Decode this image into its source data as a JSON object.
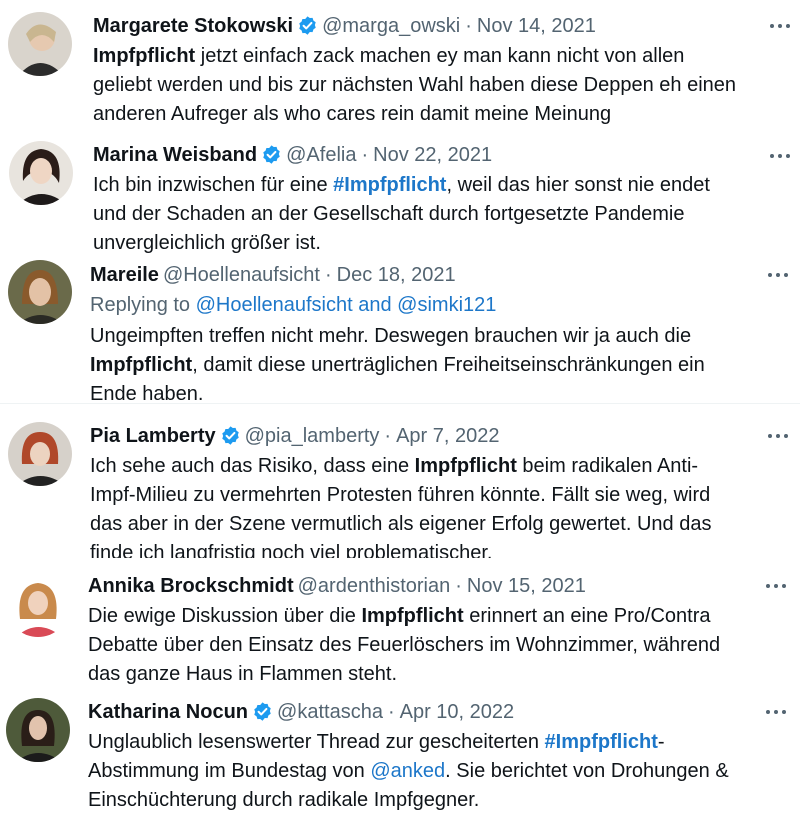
{
  "colors": {
    "link": "#1d77c9",
    "verified": "#1d9bf0",
    "muted": "#536471",
    "text": "#0f1419"
  },
  "icons": {
    "verified": "verified-badge-icon",
    "more": "more-options-icon"
  },
  "tweets": [
    {
      "name": "Margarete Stokowski",
      "verified": true,
      "handle": "@marga_owski",
      "dot": "·",
      "date": "Nov 14, 2021",
      "lines": [
        {
          "bold": "Impfpflicht",
          "rest": " jetzt einfach zack machen ey man kann nicht von allen"
        },
        {
          "text": "geliebt werden und bis zur nächsten Wahl haben diese Deppen eh einen"
        },
        {
          "text": "anderen Aufreger als who cares rein damit meine Meinung"
        }
      ]
    },
    {
      "name": "Marina Weisband",
      "verified": true,
      "handle": "@Afelia",
      "dot": "·",
      "date": "Nov 22, 2021",
      "lines": [
        {
          "pre": "Ich bin inzwischen für eine ",
          "tag": "#Impfpflicht",
          "post": ", weil das hier sonst nie endet"
        },
        {
          "text": "und der Schaden an der Gesellschaft durch fortgesetzte Pandemie"
        },
        {
          "text": "unvergleichlich größer ist."
        }
      ]
    },
    {
      "name": "Mareile",
      "verified": false,
      "handle": "@Hoellenaufsicht",
      "dot": "·",
      "date": "Dec 18, 2021",
      "reply": {
        "prefix": "Replying to ",
        "link1": "@Hoellenaufsicht",
        "and": " and ",
        "link2": "@simki121"
      },
      "lines": [
        {
          "text": "Ungeimpften treffen nicht mehr. Deswegen brauchen wir ja auch die"
        },
        {
          "bold": "Impfpflicht",
          "rest": ", damit diese unerträglichen Freiheitseinschränkungen ein"
        },
        {
          "text": "Ende haben."
        }
      ]
    },
    {
      "name": "Pia Lamberty",
      "verified": true,
      "handle": "@pia_lamberty",
      "dot": "·",
      "date": "Apr 7, 2022",
      "lines": [
        {
          "pre": "Ich sehe auch das Risiko, dass eine ",
          "bold": "Impfpflicht",
          "post": " beim radikalen Anti-"
        },
        {
          "text": "Impf-Milieu zu vermehrten Protesten führen könnte. Fällt sie weg, wird"
        },
        {
          "text": "das aber in der Szene vermutlich als eigener Erfolg gewertet. Und das"
        },
        {
          "text": "finde ich langfristig noch viel problematischer."
        }
      ]
    },
    {
      "name": "Annika Brockschmidt",
      "verified": false,
      "handle": "@ardenthistorian",
      "dot": "·",
      "date": "Nov 15, 2021",
      "lines": [
        {
          "pre": "Die ewige Diskussion über die ",
          "bold": "Impfpflicht",
          "post": " erinnert an eine Pro/Contra"
        },
        {
          "text": "Debatte über den Einsatz des Feuerlöschers im Wohnzimmer, während"
        },
        {
          "text": "das ganze Haus in Flammen steht."
        }
      ]
    },
    {
      "name": "Katharina Nocun",
      "verified": true,
      "handle": "@kattascha",
      "dot": "·",
      "date": "Apr 10, 2022",
      "lines": [
        {
          "pre": "Unglaublich lesenswerter Thread zur gescheiterten ",
          "tag": "#Impfpflicht",
          "post": "-"
        },
        {
          "pre": "Abstimmung im Bundestag von ",
          "link": "@anked",
          "post": ". Sie berichtet von Drohungen &"
        },
        {
          "text": "Einschüchterung durch radikale Impfgegner."
        }
      ]
    }
  ]
}
